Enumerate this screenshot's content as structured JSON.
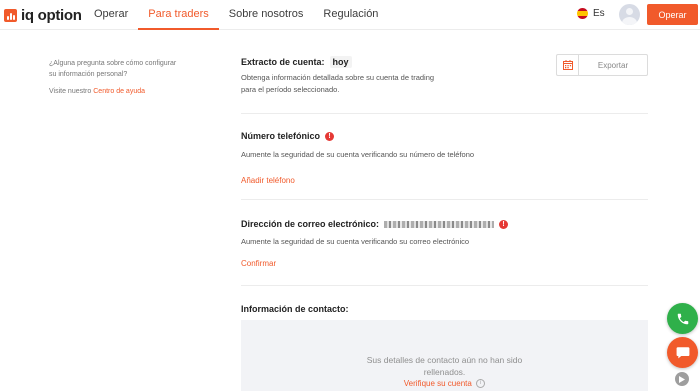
{
  "header": {
    "logo_text": "iq option",
    "nav": [
      {
        "label": "Operar",
        "active": false
      },
      {
        "label": "Para traders",
        "active": true
      },
      {
        "label": "Sobre nosotros",
        "active": false
      },
      {
        "label": "Regulación",
        "active": false
      }
    ],
    "language": "Es",
    "operar_button": "Operar",
    "accent_color": "#f15a2b"
  },
  "sidebar": {
    "question": "¿Alguna pregunta sobre cómo configurar su información personal?",
    "visit_prefix": "Visite nuestro",
    "help_link": "Centro de ayuda"
  },
  "statement": {
    "title": "Extracto de cuenta:",
    "period": "hoy",
    "description_line1": "Obtenga información detallada sobre su cuenta de trading",
    "description_line2": "para el período seleccionado.",
    "export_label": "Exportar"
  },
  "phone": {
    "title": "Número telefónico",
    "description": "Aumente la seguridad de su cuenta verificando su número de teléfono",
    "link": "Añadir teléfono"
  },
  "email": {
    "title": "Dirección de correo electrónico:",
    "description": "Aumente la seguridad de su cuenta verificando su correo electrónico",
    "link": "Confirmar"
  },
  "contact": {
    "title": "Información de contacto:",
    "empty_line1": "Sus detalles de contacto aún no han sido",
    "empty_line2": "rellenados.",
    "verify_link": "Verifique su cuenta"
  },
  "icons": {
    "warning": "!",
    "info": "i"
  }
}
